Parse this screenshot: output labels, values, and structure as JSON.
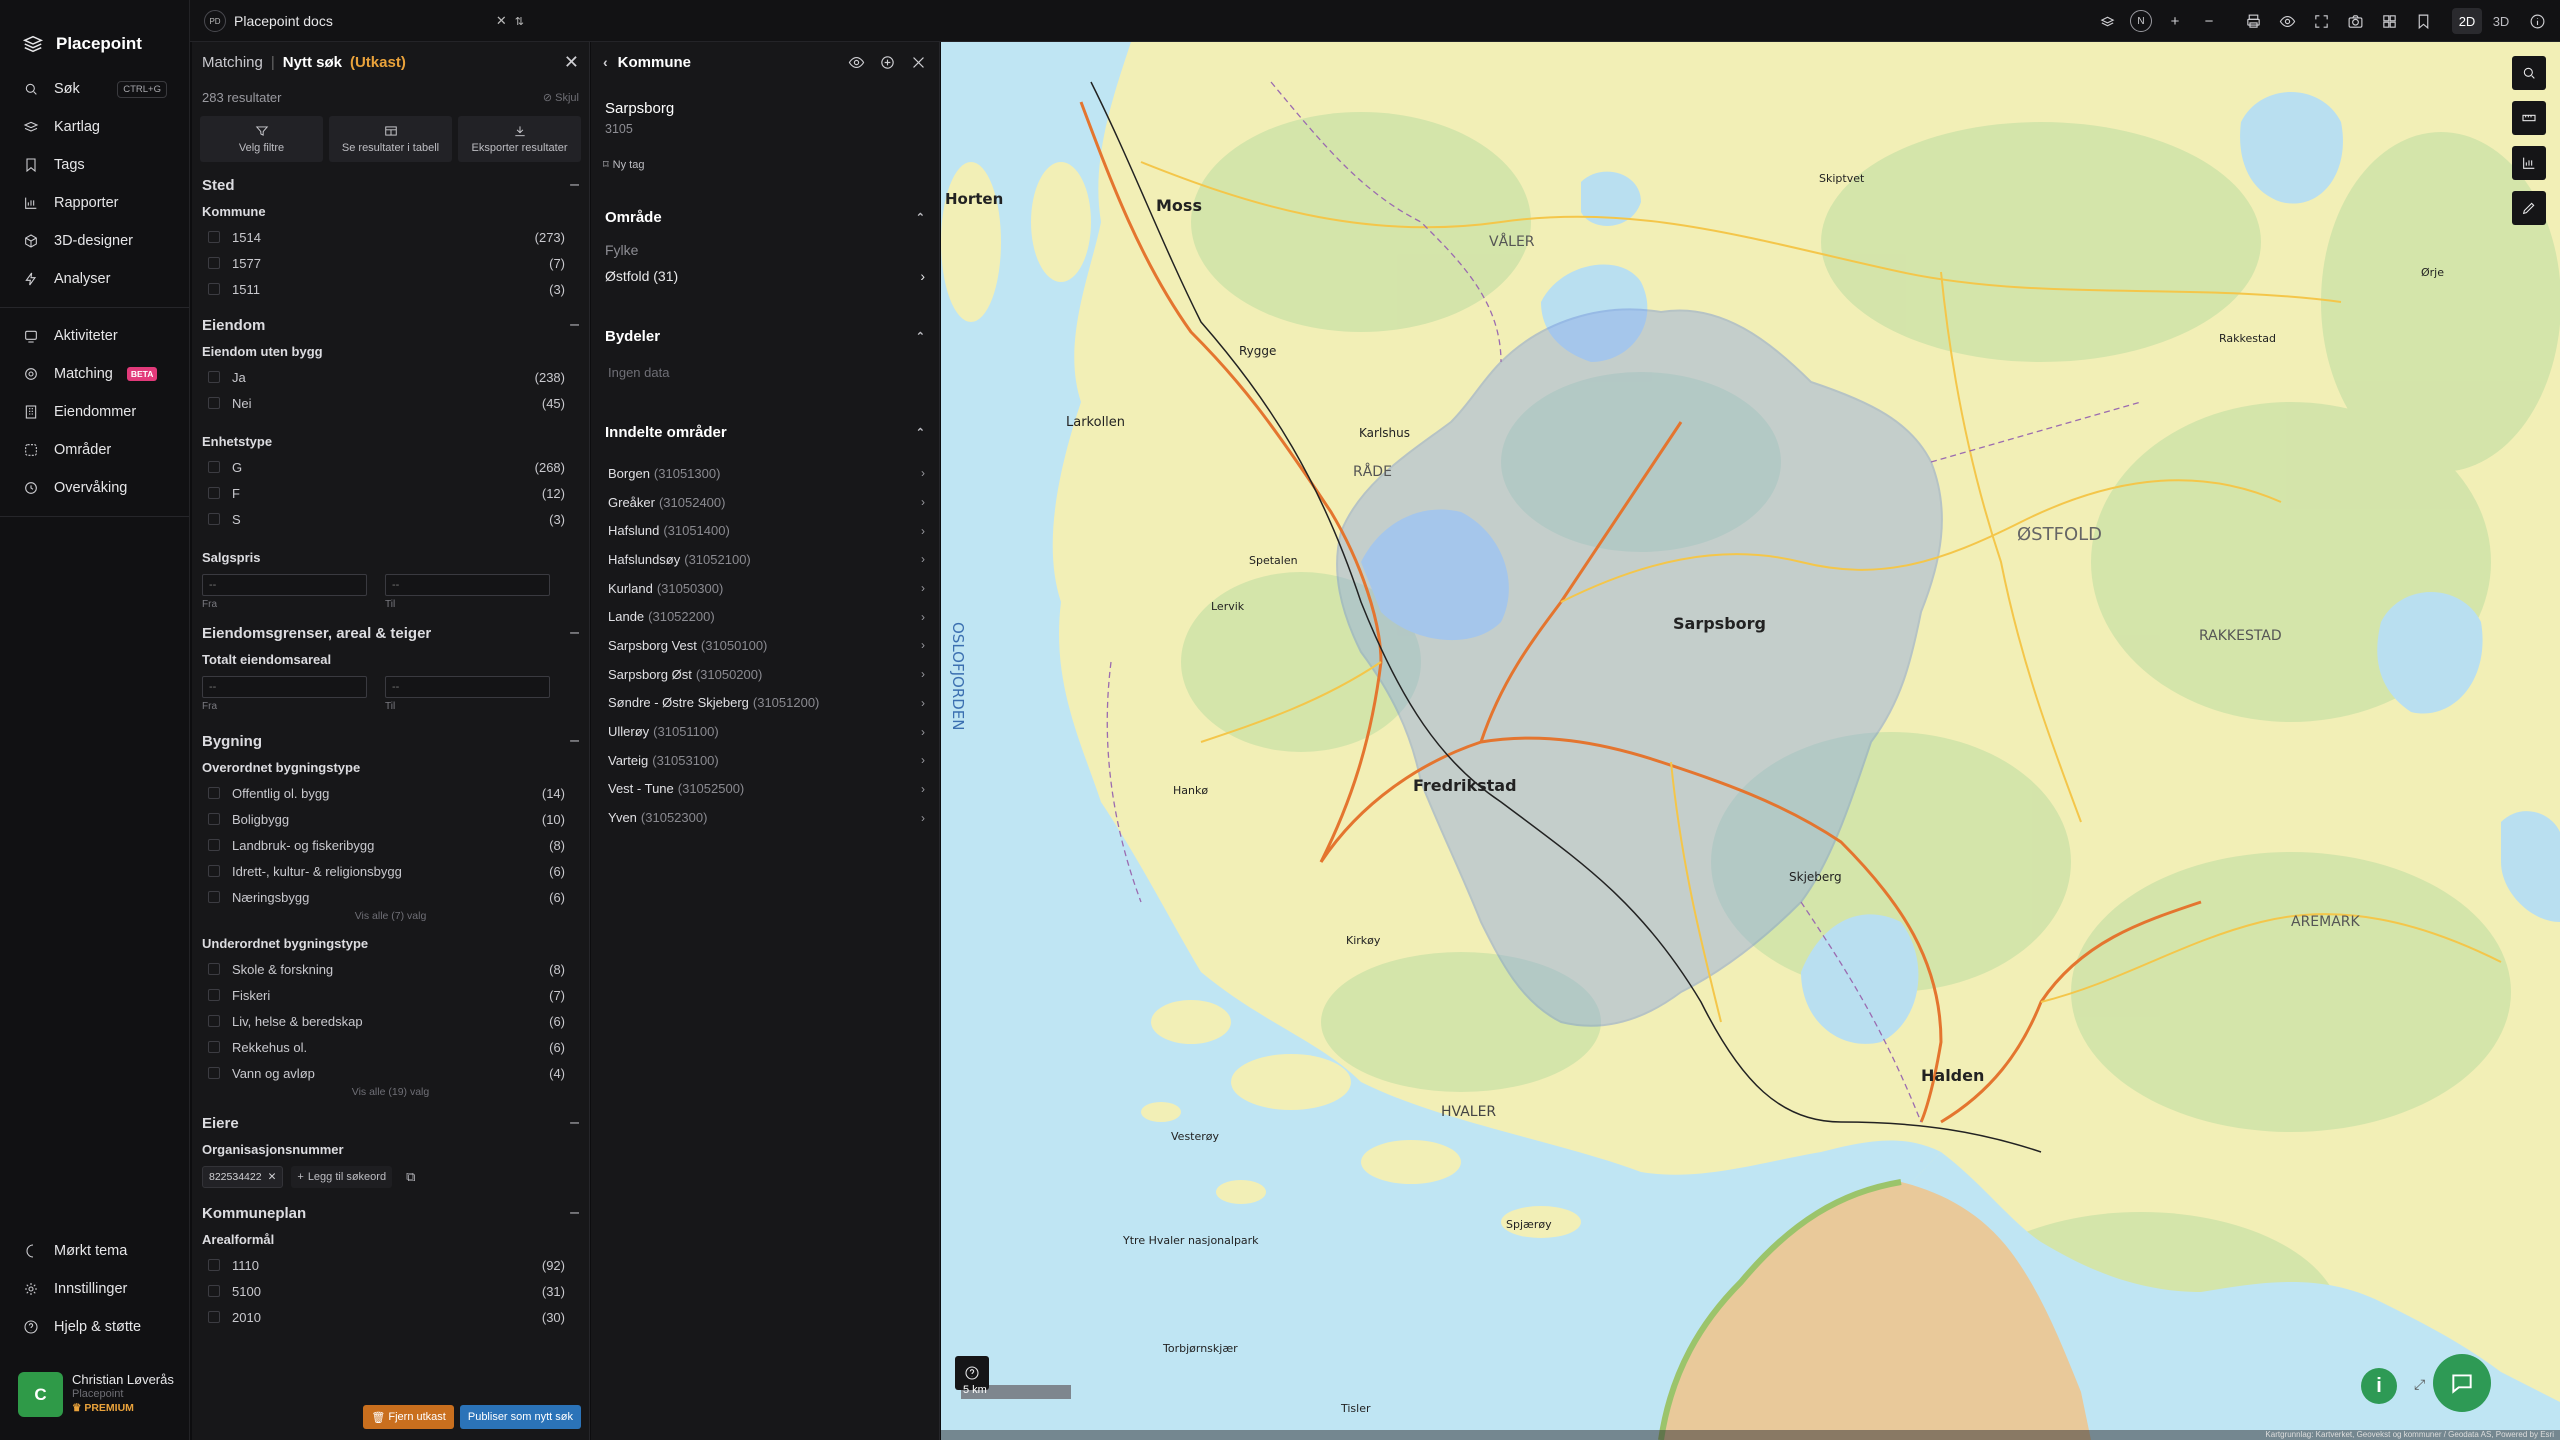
{
  "nav": {
    "brand": "Placepoint",
    "items": [
      {
        "label": "Søk",
        "icon": "search-icon",
        "kbd": "CTRL+G"
      },
      {
        "label": "Kartlag",
        "icon": "layers-icon"
      },
      {
        "label": "Tags",
        "icon": "bookmark-icon"
      },
      {
        "label": "Rapporter",
        "icon": "chart-icon"
      },
      {
        "label": "3D-designer",
        "icon": "cube-icon"
      },
      {
        "label": "Analyser",
        "icon": "bolt-icon"
      }
    ],
    "items2": [
      {
        "label": "Aktiviteter",
        "icon": "activity-icon"
      },
      {
        "label": "Matching",
        "icon": "target-icon",
        "badge": "BETA"
      },
      {
        "label": "Eiendommer",
        "icon": "building-icon"
      },
      {
        "label": "Områder",
        "icon": "area-icon"
      },
      {
        "label": "Overvåking",
        "icon": "monitor-icon"
      }
    ],
    "bottom": [
      {
        "label": "Mørkt tema",
        "icon": "moon-icon"
      },
      {
        "label": "Innstillinger",
        "icon": "gear-icon"
      },
      {
        "label": "Hjelp & støtte",
        "icon": "help-icon"
      }
    ],
    "user": {
      "initial": "C",
      "name": "Christian Løverås",
      "org": "Placepoint",
      "plan": "PREMIUM"
    }
  },
  "topbar": {
    "doc_badge": "PD",
    "doc_name": "Placepoint docs",
    "north": "N",
    "mode_2d": "2D",
    "mode_3d": "3D"
  },
  "matching": {
    "crumb": "Matching",
    "title": "Nytt søk",
    "draft": "(Utkast)",
    "results": "283 resultater",
    "hide": "Skjul",
    "actions": [
      "Velg filtre",
      "Se resultater i tabell",
      "Eksporter resultater"
    ],
    "sted": {
      "title": "Sted",
      "kommune_label": "Kommune",
      "kommune": [
        {
          "v": "1514",
          "c": "(273)"
        },
        {
          "v": "1577",
          "c": "(7)"
        },
        {
          "v": "1511",
          "c": "(3)"
        }
      ]
    },
    "eiendom": {
      "title": "Eiendom",
      "uten_bygg_label": "Eiendom uten bygg",
      "uten_bygg": [
        {
          "v": "Ja",
          "c": "(238)"
        },
        {
          "v": "Nei",
          "c": "(45)"
        }
      ],
      "enhet_label": "Enhetstype",
      "enhet": [
        {
          "v": "G",
          "c": "(268)"
        },
        {
          "v": "F",
          "c": "(12)"
        },
        {
          "v": "S",
          "c": "(3)"
        }
      ],
      "salgspris_label": "Salgspris",
      "from_label": "Fra",
      "to_label": "Til",
      "placeholder": "--"
    },
    "grenser": {
      "title": "Eiendomsgrenser, areal & teiger",
      "areal_label": "Totalt eiendomsareal"
    },
    "bygning": {
      "title": "Bygning",
      "over_label": "Overordnet bygningstype",
      "over": [
        {
          "v": "Offentlig ol. bygg",
          "c": "(14)"
        },
        {
          "v": "Boligbygg",
          "c": "(10)"
        },
        {
          "v": "Landbruk- og fiskeribygg",
          "c": "(8)"
        },
        {
          "v": "Idrett-, kultur- & religionsbygg",
          "c": "(6)"
        },
        {
          "v": "Næringsbygg",
          "c": "(6)"
        }
      ],
      "over_showall": "Vis alle (7) valg",
      "under_label": "Underordnet bygningstype",
      "under": [
        {
          "v": "Skole & forskning",
          "c": "(8)"
        },
        {
          "v": "Fiskeri",
          "c": "(7)"
        },
        {
          "v": "Liv, helse & beredskap",
          "c": "(6)"
        },
        {
          "v": "Rekkehus ol.",
          "c": "(6)"
        },
        {
          "v": "Vann og avløp",
          "c": "(4)"
        }
      ],
      "under_showall": "Vis alle (19) valg"
    },
    "eiere": {
      "title": "Eiere",
      "org_label": "Organisasjonsnummer",
      "org_value": "822534422",
      "add_kw": "Legg til søkeord"
    },
    "kommuneplan": {
      "title": "Kommuneplan",
      "areal_label": "Arealformål",
      "areal": [
        {
          "v": "1110",
          "c": "(92)"
        },
        {
          "v": "5100",
          "c": "(31)"
        },
        {
          "v": "2010",
          "c": "(30)"
        }
      ]
    },
    "btn_remove": "Fjern utkast",
    "btn_publish": "Publiser som nytt søk"
  },
  "kommune": {
    "title": "Kommune",
    "name": "Sarpsborg",
    "number": "3105",
    "new_tag": "Ny tag",
    "omrade_title": "Område",
    "fylke_label": "Fylke",
    "fylke_value": "Østfold (31)",
    "bydeler_title": "Bydeler",
    "no_data": "Ingen data",
    "inndelte_title": "Inndelte områder",
    "inndelte": [
      {
        "n": "Borgen",
        "c": "(31051300)"
      },
      {
        "n": "Greåker",
        "c": "(31052400)"
      },
      {
        "n": "Hafslund",
        "c": "(31051400)"
      },
      {
        "n": "Hafslundsøy",
        "c": "(31052100)"
      },
      {
        "n": "Kurland",
        "c": "(31050300)"
      },
      {
        "n": "Lande",
        "c": "(31052200)"
      },
      {
        "n": "Sarpsborg Vest",
        "c": "(31050100)"
      },
      {
        "n": "Sarpsborg Øst",
        "c": "(31050200)"
      },
      {
        "n": "Søndre - Østre Skjeberg",
        "c": "(31051200)"
      },
      {
        "n": "Ullerøy",
        "c": "(31051100)"
      },
      {
        "n": "Varteig",
        "c": "(31053100)"
      },
      {
        "n": "Vest - Tune",
        "c": "(31052500)"
      },
      {
        "n": "Yven",
        "c": "(31052300)"
      }
    ]
  },
  "map": {
    "scale": "5 km",
    "attribution": "Kartgrunnlag: Kartverket, Geovekst og kommuner / Geodata AS, Powered by Esri",
    "places": [
      "Moss",
      "Horten",
      "Rygge",
      "Larkollen",
      "Karlshus",
      "Sarpsborg",
      "Fredrikstad",
      "Halden",
      "HVALER",
      "ØSTFOLD",
      "OSLOFJORDEN",
      "Spetalen",
      "Lervik",
      "Skjeberg",
      "Ytre Hvaler nasjonalpark",
      "Torbjørnskjær",
      "Tisler",
      "Skiptvet",
      "VÅLER",
      "RÅDE",
      "RAKKESTAD",
      "AREMARK",
      "Rakkestad",
      "Ørje",
      "Hankø",
      "Vesterøy",
      "Kirkøy",
      "Spjærøy"
    ]
  },
  "colors": {
    "accent": "#e9a23b",
    "publish": "#2b73b8",
    "remove": "#c96f1e",
    "beta": "#e23a7a",
    "avatar": "#2f9a48"
  }
}
